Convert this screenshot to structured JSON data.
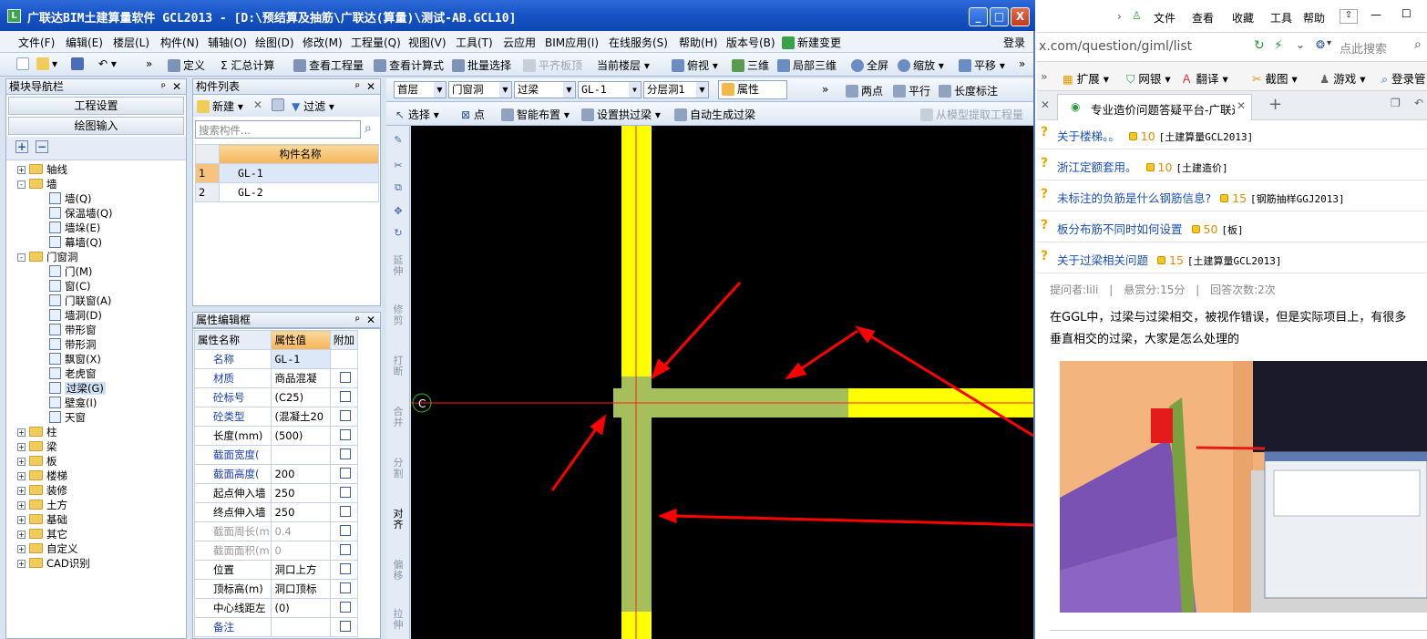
{
  "window": {
    "title": "广联达BIM土建算量软件 GCL2013 - [D:\\预结算及抽筋\\广联达(算量)\\测试-AB.GCL10]",
    "min": "_",
    "max": "□",
    "close": "X"
  },
  "menu": [
    "文件(F)",
    "编辑(E)",
    "楼层(L)",
    "构件(N)",
    "辅轴(O)",
    "绘图(D)",
    "修改(M)",
    "工程量(Q)",
    "视图(V)",
    "工具(T)",
    "云应用",
    "BIM应用(I)",
    "在线服务(S)",
    "帮助(H)",
    "版本号(B)",
    "新建变更",
    "登录"
  ],
  "toolbar1": {
    "define": "定义",
    "sum": "Σ 汇总计算",
    "view_qty": "查看工程量",
    "view_formula": "查看计算式",
    "batch_select": "批量选择",
    "flush_slab": "平齐板顶",
    "floor": "当前楼层",
    "view": "俯视",
    "three_d": "三维",
    "local_3d": "局部三维",
    "fullscreen": "全屏",
    "zoom": "缩放",
    "pan": "平移"
  },
  "nav": {
    "title": "模块导航栏",
    "btn_settings": "工程设置",
    "btn_draw": "绘图输入",
    "tree": [
      {
        "label": "轴线",
        "level": 0,
        "expander": "+"
      },
      {
        "label": "墙",
        "level": 0,
        "expander": "-"
      },
      {
        "label": "墙(Q)",
        "level": 1
      },
      {
        "label": "保温墙(Q)",
        "level": 1
      },
      {
        "label": "墙垛(E)",
        "level": 1
      },
      {
        "label": "幕墙(Q)",
        "level": 1
      },
      {
        "label": "门窗洞",
        "level": 0,
        "expander": "-"
      },
      {
        "label": "门(M)",
        "level": 1
      },
      {
        "label": "窗(C)",
        "level": 1
      },
      {
        "label": "门联窗(A)",
        "level": 1
      },
      {
        "label": "墙洞(D)",
        "level": 1
      },
      {
        "label": "带形窗",
        "level": 1
      },
      {
        "label": "带形洞",
        "level": 1
      },
      {
        "label": "飘窗(X)",
        "level": 1
      },
      {
        "label": "老虎窗",
        "level": 1
      },
      {
        "label": "过梁(G)",
        "level": 1,
        "selected": true
      },
      {
        "label": "壁龛(I)",
        "level": 1
      },
      {
        "label": "天窗",
        "level": 1
      },
      {
        "label": "柱",
        "level": 0,
        "expander": "+"
      },
      {
        "label": "梁",
        "level": 0,
        "expander": "+"
      },
      {
        "label": "板",
        "level": 0,
        "expander": "+"
      },
      {
        "label": "楼梯",
        "level": 0,
        "expander": "+"
      },
      {
        "label": "装修",
        "level": 0,
        "expander": "+"
      },
      {
        "label": "土方",
        "level": 0,
        "expander": "+"
      },
      {
        "label": "基础",
        "level": 0,
        "expander": "+"
      },
      {
        "label": "其它",
        "level": 0,
        "expander": "+"
      },
      {
        "label": "自定义",
        "level": 0,
        "expander": "+"
      },
      {
        "label": "CAD识别",
        "level": 0,
        "expander": "+"
      }
    ]
  },
  "complist": {
    "title": "构件列表",
    "new_btn": "新建",
    "filter_btn": "过滤",
    "search_placeholder": "搜索构件...",
    "col_name": "构件名称",
    "rows": [
      {
        "no": "1",
        "name": "GL-1"
      },
      {
        "no": "2",
        "name": "GL-2"
      }
    ]
  },
  "props": {
    "title": "属性编辑框",
    "col_name": "属性名称",
    "col_value": "属性值",
    "col_extra": "附加",
    "rows": [
      {
        "name": "名称",
        "value": "GL-1",
        "blue": true,
        "check": false
      },
      {
        "name": "材质",
        "value": "商品混凝",
        "blue": true,
        "check": true
      },
      {
        "name": "砼标号",
        "value": "(C25)",
        "blue": true,
        "check": true
      },
      {
        "name": "砼类型",
        "value": "(混凝土20",
        "blue": true,
        "check": true
      },
      {
        "name": "长度(mm)",
        "value": "(500)",
        "blue": false,
        "check": true
      },
      {
        "name": "截面宽度(",
        "value": "",
        "blue": true,
        "check": true
      },
      {
        "name": "截面高度(",
        "value": "200",
        "blue": true,
        "check": true
      },
      {
        "name": "起点伸入墙",
        "value": "250",
        "blue": false,
        "check": true
      },
      {
        "name": "终点伸入墙",
        "value": "250",
        "blue": false,
        "check": true
      },
      {
        "name": "截面周长(m",
        "value": "0.4",
        "blue": false,
        "grey": true,
        "check": true
      },
      {
        "name": "截面面积(m",
        "value": "0",
        "blue": false,
        "grey": true,
        "check": true
      },
      {
        "name": "位置",
        "value": "洞口上方",
        "blue": false,
        "check": true
      },
      {
        "name": "顶标高(m)",
        "value": "洞口顶标",
        "blue": false,
        "check": true
      },
      {
        "name": "中心线距左",
        "value": "(0)",
        "blue": false,
        "check": true
      },
      {
        "name": "备注",
        "value": "",
        "blue": true,
        "check": true
      }
    ]
  },
  "canvasbar": {
    "floor": "首层",
    "category": "门窗洞",
    "type": "过梁",
    "component": "GL-1",
    "layer": "分层洞1",
    "props_btn": "属性",
    "two_point": "两点",
    "parallel": "平行",
    "length_mark": "长度标注",
    "select": "选择",
    "point": "点",
    "smart_place": "智能布置",
    "arch_beam": "设置拱过梁",
    "auto_gen": "自动生成过梁",
    "extract": "从模型提取工程量"
  },
  "vtools": [
    "延伸",
    "修剪",
    "打断",
    "合并",
    "分割",
    "对齐",
    "偏移",
    "拉伸"
  ],
  "canvas": {
    "marker": "C"
  },
  "browser": {
    "nav_items": [
      "文件",
      "查看",
      "收藏",
      "工具",
      "帮助"
    ],
    "url": "x.com/question/giml/list",
    "search_placeholder": "点此搜索",
    "ext_items": [
      "扩展",
      "网银",
      "翻译",
      "截图",
      "游戏",
      "登录管"
    ],
    "tab_title": "专业造价问题答疑平台-广联达",
    "questions": [
      {
        "title": "关于楼梯。。",
        "score": "10",
        "cat": "[土建算量GCL2013]"
      },
      {
        "title": "浙江定额套用。",
        "score": "10",
        "cat": "[土建造价]"
      },
      {
        "title": "未标注的负筋是什么钢筋信息?",
        "score": "15",
        "cat": "[钢筋抽样GGJ2013]"
      },
      {
        "title": "板分布筋不同时如何设置",
        "score": "50",
        "cat": "[板]"
      },
      {
        "title": "关于过梁相关问题",
        "score": "15",
        "cat": "[土建算量GCL2013]"
      }
    ],
    "meta": {
      "asker": "提问者:lili",
      "reward": "悬赏分:15分",
      "answers": "回答次数:2次"
    },
    "body_line1": "在GGL中，过梁与过梁相交，被视作错误，但是实际项目上，有很多",
    "body_line2": "垂直相交的过梁，大家是怎么处理的"
  }
}
